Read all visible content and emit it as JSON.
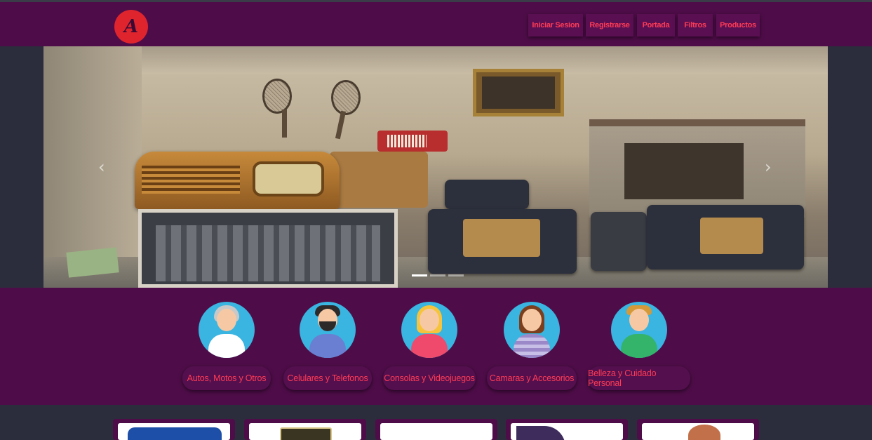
{
  "brand": {
    "logo_letter": "A",
    "logo_color": "#e0242e"
  },
  "nav": {
    "items": [
      {
        "label": "Iniciar Sesion"
      },
      {
        "label": "Registrarse"
      },
      {
        "label": "Portada"
      },
      {
        "label": "Filtros"
      },
      {
        "label": "Productos"
      }
    ]
  },
  "carousel": {
    "slide_count": 3,
    "active_slide": 1,
    "prev_icon": "chevron-left-icon",
    "next_icon": "chevron-right-icon"
  },
  "categories": [
    {
      "label": "Autos, Motos y Otros",
      "avatar": "elderly-woman-avatar"
    },
    {
      "label": "Celulares y Telefonos",
      "avatar": "bearded-man-avatar"
    },
    {
      "label": "Consolas y Videojuegos",
      "avatar": "blonde-woman-avatar"
    },
    {
      "label": "Camaras y Accesorios",
      "avatar": "woman-phone-avatar"
    },
    {
      "label": "Belleza y Cuidado Personal",
      "avatar": "young-man-avatar"
    }
  ],
  "colors": {
    "primary": "#4e0d48",
    "accent": "#ff3b55",
    "background": "#2b2d3c",
    "avatar_bg": "#3ab4e0"
  }
}
